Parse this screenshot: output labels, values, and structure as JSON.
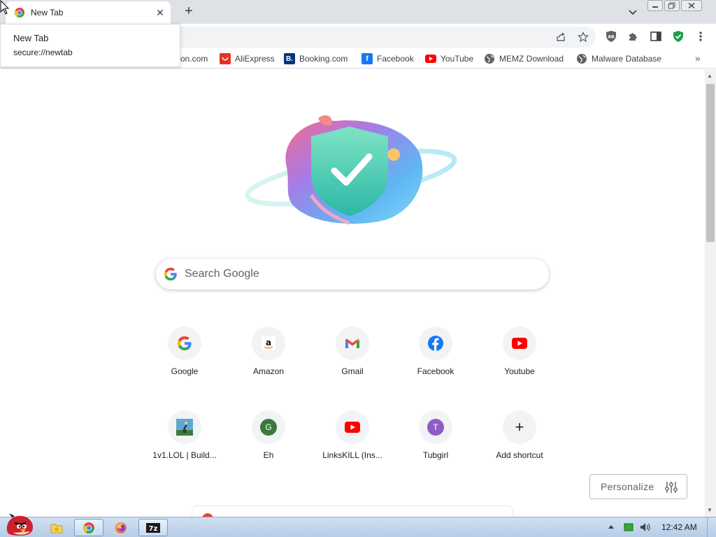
{
  "browser": {
    "tab_title": "New Tab",
    "new_tab_symbol": "+",
    "close_symbol": "✕"
  },
  "tooltip": {
    "title": "New Tab",
    "url": "secure://newtab"
  },
  "bookmarks": [
    {
      "label": "on.com",
      "icon": "amazon-icon"
    },
    {
      "label": "AliExpress",
      "icon": "aliexpress-icon",
      "color": "#e43225"
    },
    {
      "label": "Booking.com",
      "icon": "booking-icon",
      "color": "#003580"
    },
    {
      "label": "Facebook",
      "icon": "facebook-icon",
      "color": "#1877f2"
    },
    {
      "label": "YouTube",
      "icon": "youtube-icon",
      "color": "#ff0000"
    },
    {
      "label": "MEMZ Download",
      "icon": "globe-icon"
    },
    {
      "label": "Malware Database",
      "icon": "globe-icon"
    }
  ],
  "bookmarks_more": "»",
  "search": {
    "placeholder": "Search Google"
  },
  "shortcuts": [
    {
      "label": "Google",
      "icon": "google-icon"
    },
    {
      "label": "Amazon",
      "icon": "amazon-icon"
    },
    {
      "label": "Gmail",
      "icon": "gmail-icon"
    },
    {
      "label": "Facebook",
      "icon": "facebook-icon"
    },
    {
      "label": "Youtube",
      "icon": "youtube-icon"
    },
    {
      "label": "1v1.LOL | Build...",
      "icon": "game-icon"
    },
    {
      "label": "Eh",
      "icon": "letter-icon",
      "letter": "G",
      "color": "#3d7a3a"
    },
    {
      "label": "LinksKILL (Ins...",
      "icon": "youtube-icon"
    },
    {
      "label": "Tubgirl",
      "icon": "letter-icon",
      "letter": "T",
      "color": "#8e5cc7"
    },
    {
      "label": "Add shortcut",
      "icon": "plus-icon",
      "symbol": "+"
    }
  ],
  "personalize": {
    "label": "Personalize"
  },
  "taskbar": {
    "clock": "12:42 AM"
  },
  "colors": {
    "tabstrip": "#dee1e6",
    "accent": "#1a73e8"
  }
}
